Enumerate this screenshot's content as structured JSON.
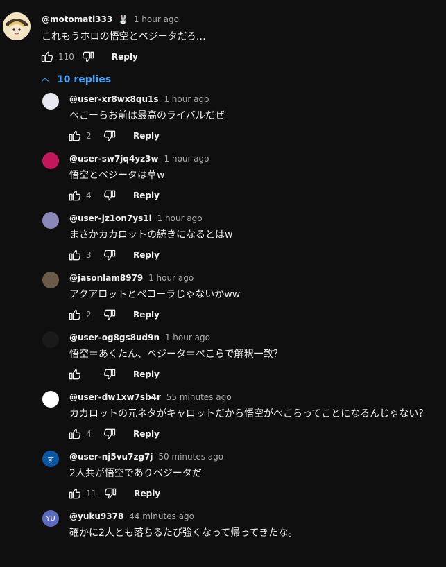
{
  "top_comment": {
    "author": "@motomati333",
    "badge": "🐰",
    "time": "1 hour ago",
    "text": "これもうホロの悟空とベジータだろ…",
    "likes": "110",
    "reply_label": "Reply"
  },
  "replies_toggle": {
    "label": "10 replies"
  },
  "replies": [
    {
      "author": "@user-xr8wx8qu1s",
      "time": "1 hour ago",
      "text": "ぺこーらお前は最高のライバルだぜ",
      "likes": "2",
      "reply_label": "Reply",
      "avatar_color": "#e8e8f0"
    },
    {
      "author": "@user-sw7jq4yz3w",
      "time": "1 hour ago",
      "text": "悟空とベジータは草w",
      "likes": "4",
      "reply_label": "Reply",
      "avatar_color": "#c2185b"
    },
    {
      "author": "@user-jz1on7ys1i",
      "time": "1 hour ago",
      "text": "まさかカカロットの続きになるとはw",
      "likes": "3",
      "reply_label": "Reply",
      "avatar_color": "#8a86b8"
    },
    {
      "author": "@jasonlam8979",
      "time": "1 hour ago",
      "text": "アクアロットとペコーラじゃないかww",
      "likes": "2",
      "reply_label": "Reply",
      "avatar_color": "#6b5a48"
    },
    {
      "author": "@user-og8gs8ud9n",
      "time": "1 hour ago",
      "text": "悟空＝あくたん、ベジータ＝ぺこらで解釈一致？",
      "likes": "",
      "reply_label": "Reply",
      "avatar_color": "#1a1a1a"
    },
    {
      "author": "@user-dw1xw7sb4r",
      "time": "55 minutes ago",
      "text": "カカロットの元ネタがキャロットだから悟空がぺこらってことになるんじゃない？",
      "likes": "4",
      "reply_label": "Reply",
      "avatar_color": "#ffffff"
    },
    {
      "author": "@user-nj5vu7zg7j",
      "time": "50 minutes ago",
      "text": "2人共が悟空でありベジータだ",
      "likes": "11",
      "reply_label": "Reply",
      "avatar_color": "#0b57a4",
      "initial": "す"
    },
    {
      "author": "@yuku9378",
      "time": "44 minutes ago",
      "text": "確かに2人とも落ちるたび強くなって帰ってきたな。",
      "likes": "",
      "reply_label": "",
      "avatar_color": "#5c6bc0",
      "initial": "YU"
    }
  ]
}
